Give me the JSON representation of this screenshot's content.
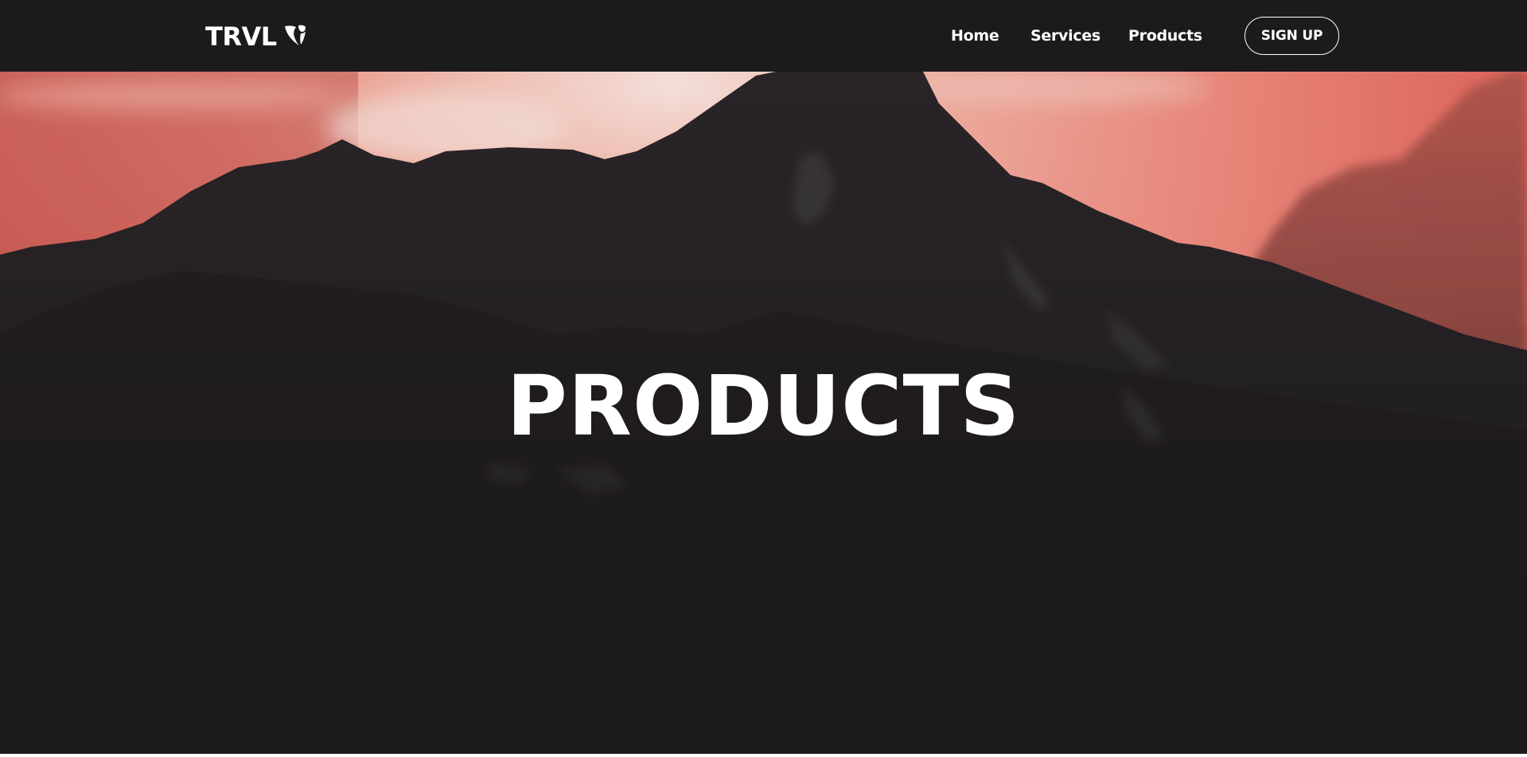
{
  "navbar": {
    "logo_text": "TRVL",
    "logo_icon": "typo3-shield-icon",
    "links": [
      {
        "label": "Home"
      },
      {
        "label": "Services"
      },
      {
        "label": "Products"
      }
    ],
    "signup_label": "SIGN UP"
  },
  "hero": {
    "title": "PRODUCTS",
    "background": "mountain-sunset-photo"
  },
  "colors": {
    "navbar_bg": "#1c1b1c",
    "sky_light": "#f6c6bb",
    "sky_accent": "#ef6b5f",
    "mountain_dark": "#242124",
    "text": "#ffffff"
  }
}
